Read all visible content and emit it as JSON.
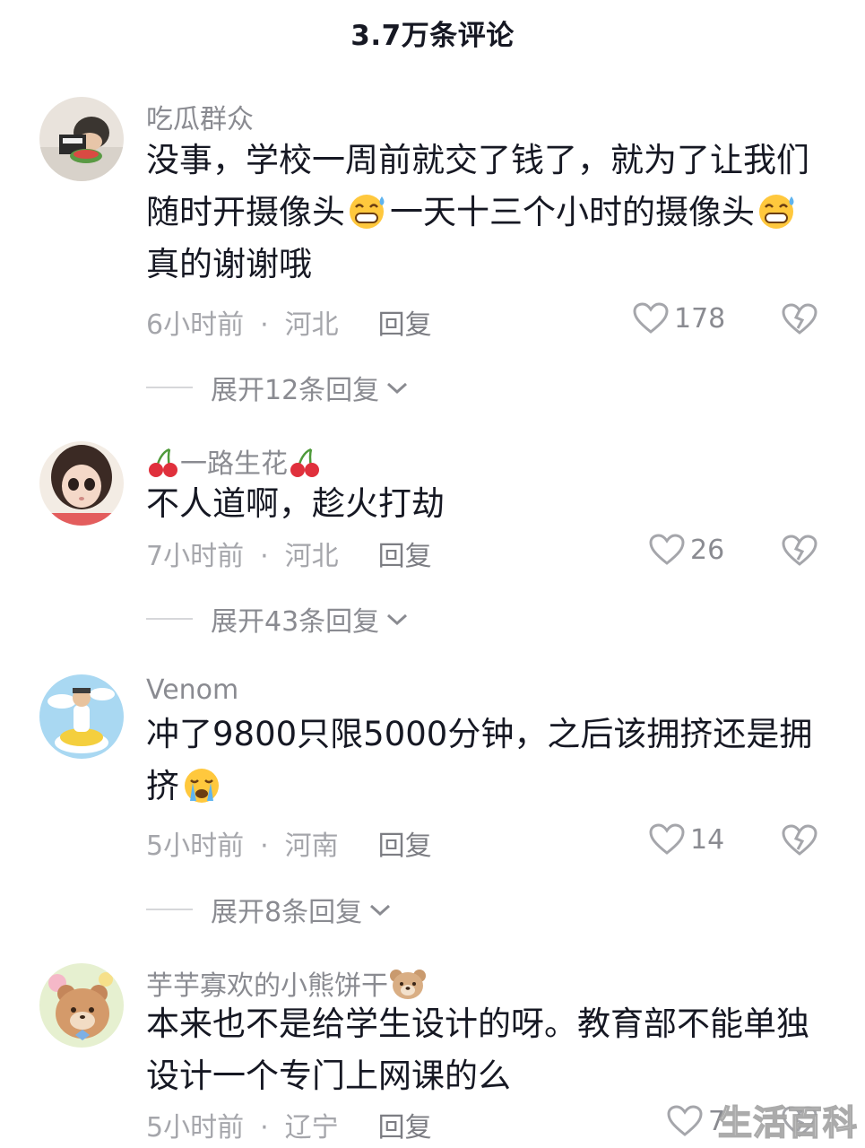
{
  "header": {
    "title": "3.7万条评论"
  },
  "comments": [
    {
      "username": "吃瓜群众",
      "text_parts": [
        "没事，学校一周前就交了钱了，就为了让我们随时开摄像头",
        "一天十三个小时的摄像头",
        "真的谢谢哦"
      ],
      "time": "6小时前",
      "location": "河北",
      "reply_label": "回复",
      "likes": "178",
      "expand_label": "展开12条回复"
    },
    {
      "username": "一路生花",
      "text_parts": [
        "不人道啊，趁火打劫"
      ],
      "time": "7小时前",
      "location": "河北",
      "reply_label": "回复",
      "likes": "26",
      "expand_label": "展开43条回复"
    },
    {
      "username": "Venom",
      "text_parts": [
        "冲了9800只限5000分钟，之后该拥挤还是拥挤"
      ],
      "time": "5小时前",
      "location": "河南",
      "reply_label": "回复",
      "likes": "14",
      "expand_label": "展开8条回复"
    },
    {
      "username": "芋芋寡欢的小熊饼干",
      "text_parts": [
        "本来也不是给学生设计的呀。教育部不能单独设计一个专门上网课的么"
      ],
      "time": "5小时前",
      "location": "辽宁",
      "reply_label": "回复",
      "likes": "7"
    }
  ],
  "watermark": "生活百科",
  "colors": {
    "text": "#161823",
    "secondary": "#8a8b91",
    "meta": "#a5a6ab"
  }
}
